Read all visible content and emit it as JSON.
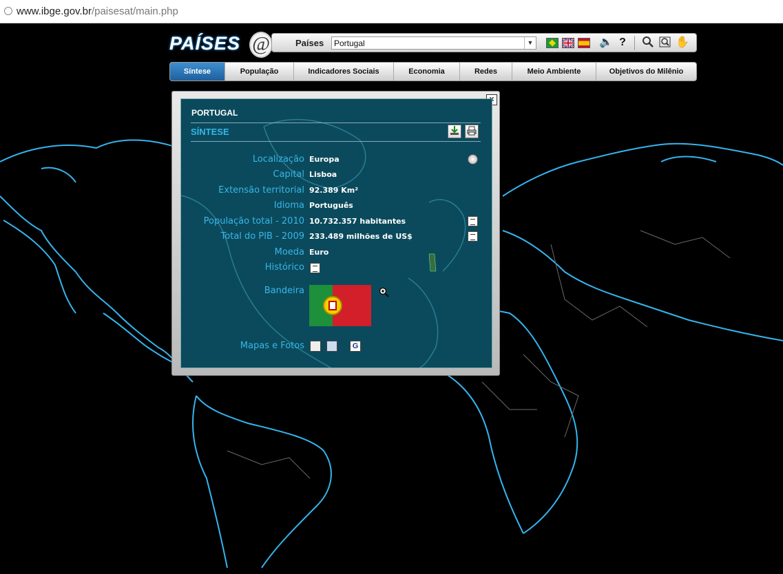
{
  "browser": {
    "url_host": "www.ibge.gov.br",
    "url_path": "/paisesat/main.php"
  },
  "logo": {
    "text": "PAÍSES",
    "mark": "@"
  },
  "toolbar": {
    "countries_label": "Países",
    "country_value": "Portugal",
    "flags": [
      "brazil-flag",
      "uk-flag",
      "spain-flag"
    ],
    "icons": [
      "sound-icon",
      "help-icon",
      "search-icon",
      "zoom-area-icon",
      "pan-hand-icon"
    ]
  },
  "tabs": [
    "Síntese",
    "População",
    "Indicadores Sociais",
    "Economia",
    "Redes",
    "Meio Ambiente",
    "Objetivos do Milênio"
  ],
  "dialog": {
    "country": "PORTUGAL",
    "section": "SÍNTESE",
    "rows": [
      {
        "label": "Localização",
        "value": "Europa"
      },
      {
        "label": "Capital",
        "value": "Lisboa"
      },
      {
        "label": "Extensão territorial",
        "value": "92.389 Km²"
      },
      {
        "label": "Idioma",
        "value": "Português"
      },
      {
        "label": "População total - 2010",
        "value": "10.732.357 habitantes"
      },
      {
        "label": "Total do PIB - 2009",
        "value": "233.489 milhões de US$"
      },
      {
        "label": "Moeda",
        "value": "Euro"
      },
      {
        "label": "Histórico",
        "value": ""
      }
    ],
    "flag_label": "Bandeira",
    "maps_label": "Mapas e Fotos",
    "close": "×"
  },
  "colors": {
    "accent": "#37b7e8",
    "panel": "#0b4a5c",
    "coast": "#35b5f0",
    "active_tab": "#2a74b8"
  }
}
